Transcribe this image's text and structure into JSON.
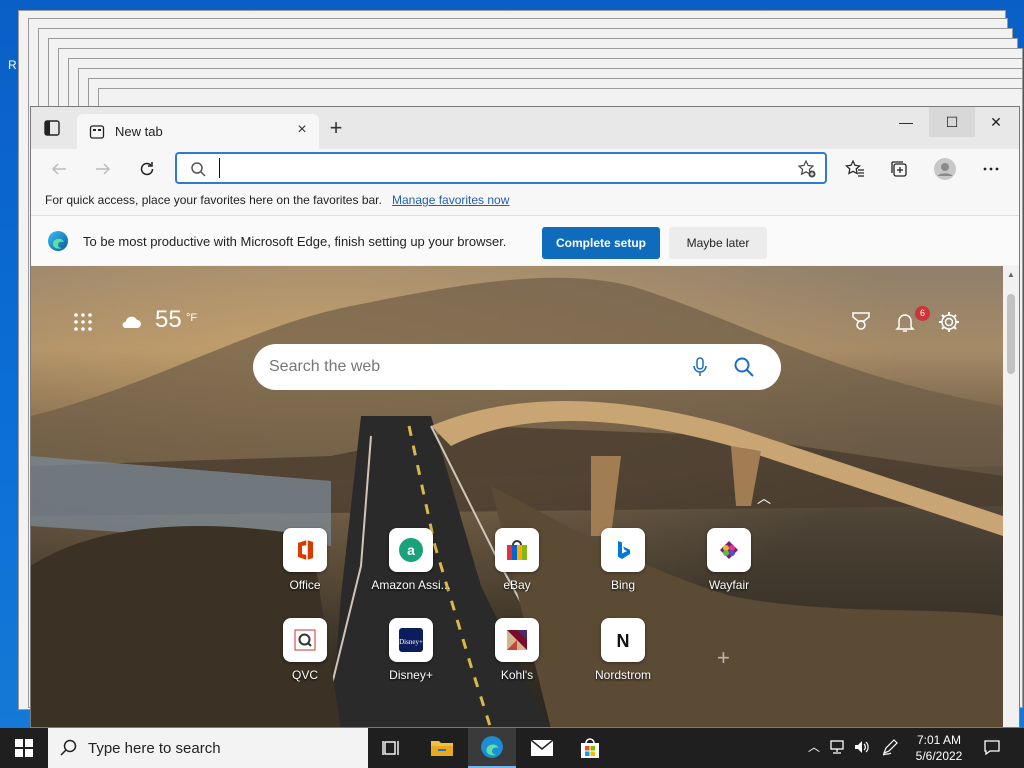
{
  "desktop": {
    "label": "R"
  },
  "browser": {
    "tab": {
      "title": "New tab",
      "close": "×"
    },
    "new_tab": "+",
    "window_controls": {
      "minimize": "—",
      "maximize": "☐",
      "close": "✕"
    },
    "address": {
      "value": "",
      "placeholder": ""
    },
    "favorites_bar": {
      "message": "For quick access, place your favorites here on the favorites bar.",
      "link": "Manage favorites now"
    },
    "setup_bar": {
      "message": "To be most productive with Microsoft Edge, finish setting up your browser.",
      "primary": "Complete setup",
      "secondary": "Maybe later"
    }
  },
  "newtab": {
    "weather": {
      "temperature": "55",
      "unit": "°F",
      "icon": "cloud-icon"
    },
    "search": {
      "placeholder": "Search the web"
    },
    "notifications": {
      "count": "6"
    },
    "quick_links": [
      {
        "label": "Office",
        "icon": "office-icon",
        "color": "#d83b01"
      },
      {
        "label": "Amazon Assi...",
        "icon": "amazon-assistant-icon",
        "color": "#1aa37a"
      },
      {
        "label": "eBay",
        "icon": "ebay-icon",
        "color": "#e53238"
      },
      {
        "label": "Bing",
        "icon": "bing-icon",
        "color": "#0078d4"
      },
      {
        "label": "Wayfair",
        "icon": "wayfair-icon",
        "color": "#7f187f"
      },
      {
        "label": "QVC",
        "icon": "qvc-icon",
        "color": "#333333"
      },
      {
        "label": "Disney+",
        "icon": "disney-plus-icon",
        "color": "#0b1e5b"
      },
      {
        "label": "Kohl's",
        "icon": "kohls-icon",
        "color": "#7a0a2c"
      },
      {
        "label": "Nordstrom",
        "icon": "nordstrom-icon",
        "color": "#111111"
      }
    ]
  },
  "taskbar": {
    "search_placeholder": "Type here to search",
    "clock": {
      "time": "7:01 AM",
      "date": "5/6/2022"
    }
  },
  "colors": {
    "accent": "#0f6cbd",
    "taskbar": "#1f1f1f",
    "badge": "#d13438"
  }
}
